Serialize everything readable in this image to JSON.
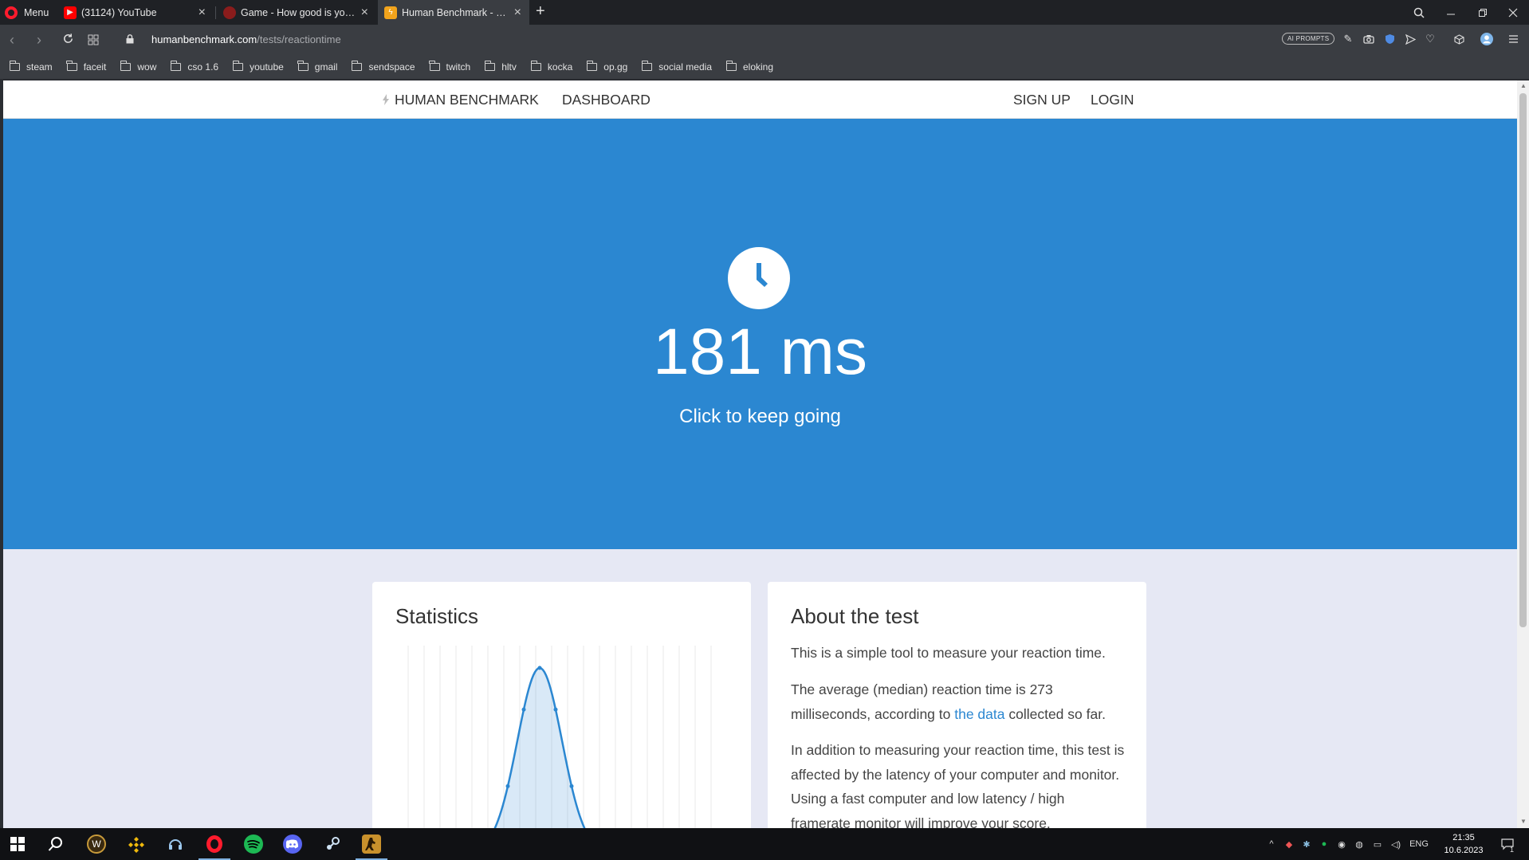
{
  "browser": {
    "menu_label": "Menu",
    "tabs": [
      {
        "title": "(31124) YouTube"
      },
      {
        "title": "Game - How good is your aim?"
      },
      {
        "title": "Human Benchmark - Reaction Time Test"
      }
    ],
    "new_tab_symbol": "+",
    "url_host": "humanbenchmark.com",
    "url_path": "/tests/reactiontime",
    "ai_prompts_label": "AI PROMPTS",
    "bookmarks": [
      "steam",
      "faceit",
      "wow",
      "cso 1.6",
      "youtube",
      "gmail",
      "sendspace",
      "twitch",
      "hltv",
      "kocka",
      "op.gg",
      "social media",
      "eloking"
    ]
  },
  "site": {
    "brand": "HUMAN BENCHMARK",
    "dashboard": "DASHBOARD",
    "signup": "SIGN UP",
    "login": "LOGIN"
  },
  "hero": {
    "result": "181 ms",
    "subtitle": "Click to keep going"
  },
  "statistics": {
    "title": "Statistics"
  },
  "about": {
    "title": "About the test",
    "p1": "This is a simple tool to measure your reaction time.",
    "p2_before": "The average (median) reaction time is 273 milliseconds, according to ",
    "p2_link": "the data",
    "p2_after": " collected so far.",
    "p3": "In addition to measuring your reaction time, this test is affected by the latency of your computer and monitor. Using a fast computer and low latency / high framerate monitor will improve your score."
  },
  "taskbar": {
    "language": "ENG",
    "time": "21:35",
    "date": "10.6.2023",
    "notifications": "1"
  },
  "colors": {
    "accent_blue": "#2b87d1",
    "page_bg": "#e6e8f4",
    "opera_red": "#ff1b2d"
  }
}
